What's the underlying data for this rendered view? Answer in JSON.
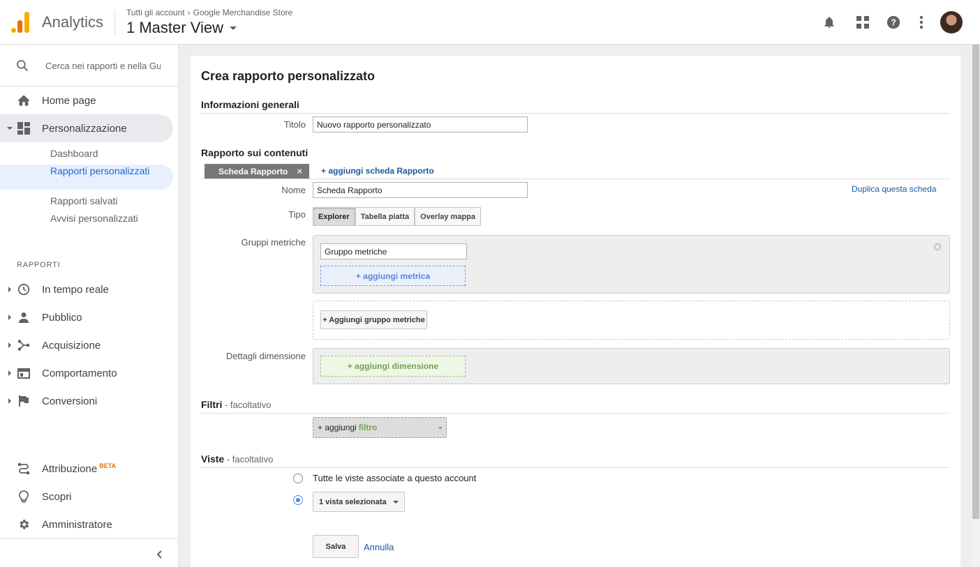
{
  "header": {
    "app_name": "Analytics",
    "breadcrumb_account": "Tutti gli account",
    "breadcrumb_property": "Google Merchandise Store",
    "view_name": "1 Master View",
    "icons": [
      "bell-icon",
      "apps-grid-icon",
      "help-icon",
      "more-vert-icon"
    ]
  },
  "sidebar": {
    "search_placeholder": "Cerca nei rapporti e nella Gu",
    "home": "Home page",
    "customization": "Personalizzazione",
    "sub_items": {
      "dashboard": "Dashboard",
      "custom_reports": "Rapporti personalizzati",
      "saved_reports": "Rapporti salvati",
      "custom_alerts": "Avvisi personalizzati"
    },
    "reports_section": "RAPPORTI",
    "reports": {
      "realtime": "In tempo reale",
      "audience": "Pubblico",
      "acquisition": "Acquisizione",
      "behavior": "Comportamento",
      "conversions": "Conversioni"
    },
    "attribution": "Attribuzione",
    "beta": "BETA",
    "discover": "Scopri",
    "admin": "Amministratore"
  },
  "main": {
    "page_title": "Crea rapporto personalizzato",
    "general_info": "Informazioni generali",
    "title_label": "Titolo",
    "title_value": "Nuovo rapporto personalizzato",
    "content_section": "Rapporto sui contenuti",
    "tab_label": "Scheda Rapporto",
    "tab_close": "×",
    "add_tab": "+ aggiungi scheda Rapporto",
    "name_label": "Nome",
    "name_value": "Scheda Rapporto",
    "duplicate_tab": "Duplica questa scheda",
    "type_label": "Tipo",
    "type_options": [
      "Explorer",
      "Tabella piatta",
      "Overlay mappa"
    ],
    "type_selected": "Explorer",
    "metric_groups_label": "Gruppi metriche",
    "metric_group_name": "Gruppo metriche",
    "add_metric": "+ aggiungi metrica",
    "add_metric_group": "+ Aggiungi gruppo metriche",
    "dimension_label": "Dettagli dimensione",
    "add_dimension": "+ aggiungi dimensione",
    "filters_section": "Filtri",
    "filters_optional": " - facoltativo",
    "add_filter_prefix": "+ aggiungi",
    "add_filter_word": "filtro",
    "views_section": "Viste",
    "views_optional": " - facoltativo",
    "all_views_option": "Tutte le viste associate a questo account",
    "selected_views": "1 vista selezionata",
    "save": "Salva",
    "cancel": "Annulla"
  }
}
